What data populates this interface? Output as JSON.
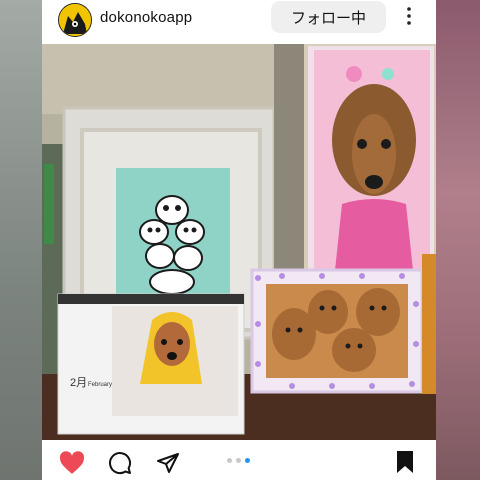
{
  "header": {
    "username": "dokonokoapp",
    "follow_label": "フォロー中"
  },
  "post": {
    "image_description": "Photo of framed pictures of dachshunds",
    "carousel": {
      "total": 3,
      "active_index": 2
    },
    "calendar_month": "2月",
    "calendar_month_en": "February"
  },
  "actions": {
    "icons": [
      "heart-icon",
      "comment-icon",
      "share-icon",
      "bookmark-icon"
    ],
    "liked": true,
    "bookmarked": true
  },
  "colors": {
    "heart": "#ed4956",
    "dot_active": "#2196f3",
    "dot_inactive": "#c8c8c8",
    "follow_bg": "#efefef"
  }
}
